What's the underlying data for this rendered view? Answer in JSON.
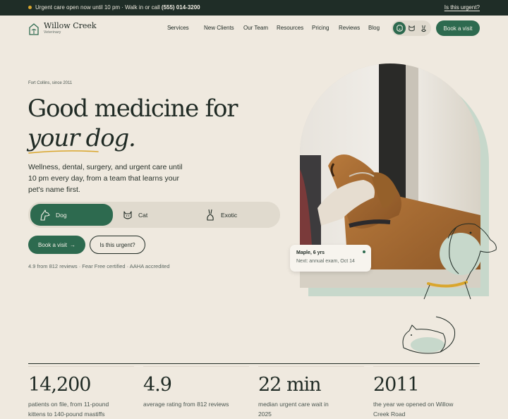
{
  "topbar": {
    "message": "Urgent care open now until 10 pm · Walk in or call",
    "phone": "(555) 014-3200",
    "urgent_link": "Is this urgent?"
  },
  "brand": {
    "name": "Willow Creek",
    "subtitle": "Veterinary"
  },
  "nav": {
    "items": [
      {
        "label": "Services",
        "has_dropdown": true
      },
      {
        "label": "New Clients"
      },
      {
        "label": "Our Team"
      },
      {
        "label": "Resources"
      },
      {
        "label": "Pricing"
      },
      {
        "label": "Reviews"
      },
      {
        "label": "Blog"
      }
    ],
    "pet_preference_icons": [
      "dog-face-icon",
      "cat-face-icon",
      "rabbit-icon"
    ],
    "book_label": "Book a visit"
  },
  "hero": {
    "eyebrow": "Fort Collins, since 2011",
    "headline_line1": "Good medicine for",
    "headline_line2": "your dog.",
    "lede": "Wellness, dental, surgery, and urgent care until 10 pm every day, from a team that learns your pet's name first.",
    "pet_tabs": [
      {
        "label": "Dog",
        "icon": "dog-icon",
        "selected": true
      },
      {
        "label": "Cat",
        "icon": "cat-icon",
        "selected": false
      },
      {
        "label": "Exotic",
        "icon": "rabbit-icon",
        "selected": false
      }
    ],
    "book_label": "Book a visit",
    "book_arrow": "→",
    "urgent_label": "Is this urgent?",
    "trust_line": "4.9 from 812 reviews · Fear Free certified · AAHA accredited"
  },
  "photo_card": {
    "pet_name": "Maple, 6 yrs",
    "next_visit": "Next: annual exam, Oct 14"
  },
  "stats": [
    {
      "value": "14,200",
      "caption": "patients on file, from 11-pound kittens to 140-pound mastiffs"
    },
    {
      "value": "4.9",
      "caption": "average rating from 812 reviews"
    },
    {
      "value": "22 min",
      "caption": "median urgent care wait in 2025"
    },
    {
      "value": "2011",
      "caption": "the year we opened on Willow Creek Road"
    }
  ],
  "colors": {
    "brand_green": "#2d6a4f",
    "dark_bar": "#1f2d27",
    "cream_bg": "#efe9df",
    "accent_gold": "#d9a62d",
    "sage": "#c7d8cb"
  }
}
